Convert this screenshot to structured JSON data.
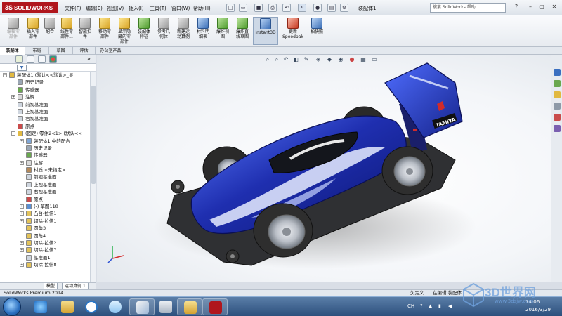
{
  "app": {
    "logo_brand": "SOLIDWORKS",
    "logo_prefix": "3S",
    "doc_title": "装配体1",
    "help_search_placeholder": "搜索 SolidWorks 帮助"
  },
  "menu": [
    "文件(F)",
    "编辑(E)",
    "视图(V)",
    "插入(I)",
    "工具(T)",
    "窗口(W)",
    "帮助(H)"
  ],
  "ribbon": {
    "buttons": [
      {
        "label": "编辑零\n部件",
        "icon": "edit-component-icon",
        "state": "disabled"
      },
      {
        "label": "插入零\n部件",
        "icon": "insert-component-icon",
        "state": "normal"
      },
      {
        "label": "配合",
        "icon": "mate-icon",
        "state": "normal"
      },
      {
        "label": "线性零\n部件...",
        "icon": "linear-pattern-icon",
        "state": "normal"
      },
      {
        "label": "智能扣\n件",
        "icon": "smart-fasteners-icon",
        "state": "normal"
      },
      {
        "label": "移动零\n部件",
        "icon": "move-component-icon",
        "state": "normal"
      },
      {
        "label": "显示隐\n藏的零\n部件",
        "icon": "show-hidden-icon",
        "state": "normal"
      },
      {
        "label": "装配体\n特征",
        "icon": "assembly-features-icon",
        "state": "normal"
      },
      {
        "label": "参考几\n何体",
        "icon": "reference-geometry-icon",
        "state": "normal"
      },
      {
        "label": "新建运\n动算例",
        "icon": "motion-study-icon",
        "state": "normal"
      },
      {
        "label": "材料明\n细表",
        "icon": "bom-icon",
        "state": "normal"
      },
      {
        "label": "爆炸视\n图",
        "icon": "exploded-view-icon",
        "state": "normal"
      },
      {
        "label": "爆炸直\n线草图",
        "icon": "explode-line-sketch-icon",
        "state": "normal"
      },
      {
        "label": "Instant3D",
        "icon": "instant3d-icon",
        "state": "active"
      },
      {
        "label": "更新\nSpeedpak",
        "icon": "speedpak-icon",
        "state": "normal"
      },
      {
        "label": "拍快照",
        "icon": "snapshot-icon",
        "state": "normal"
      }
    ]
  },
  "command_tabs": [
    "装配体",
    "布局",
    "草图",
    "评估",
    "办公室产品"
  ],
  "feature_tree": [
    {
      "label": "装配体1 (默认<<默认>_显",
      "level": 0,
      "expander": "-",
      "icon": "assembly-icon"
    },
    {
      "label": "历史记录",
      "level": 1,
      "expander": "",
      "icon": "history-icon"
    },
    {
      "label": "传感器",
      "level": 1,
      "expander": "",
      "icon": "sensor-icon"
    },
    {
      "label": "注解",
      "level": 1,
      "expander": "+",
      "icon": "annotation-icon"
    },
    {
      "label": "前视基准面",
      "level": 1,
      "expander": "",
      "icon": "plane-icon"
    },
    {
      "label": "上视基准面",
      "level": 1,
      "expander": "",
      "icon": "plane-icon"
    },
    {
      "label": "右视基准面",
      "level": 1,
      "expander": "",
      "icon": "plane-icon"
    },
    {
      "label": "原点",
      "level": 1,
      "expander": "",
      "icon": "origin-icon"
    },
    {
      "label": "(固定) 零件2<1> (默认<<",
      "level": 1,
      "expander": "-",
      "icon": "part-icon"
    },
    {
      "label": "装配体1 中的配合",
      "level": 2,
      "expander": "+",
      "icon": "mate-group-icon"
    },
    {
      "label": "历史记录",
      "level": 2,
      "expander": "",
      "icon": "history-icon"
    },
    {
      "label": "传感器",
      "level": 2,
      "expander": "",
      "icon": "sensor-icon"
    },
    {
      "label": "注解",
      "level": 2,
      "expander": "+",
      "icon": "annotation-icon"
    },
    {
      "label": "材质 <未指定>",
      "level": 2,
      "expander": "",
      "icon": "material-icon"
    },
    {
      "label": "前视基准面",
      "level": 2,
      "expander": "",
      "icon": "plane-icon"
    },
    {
      "label": "上视基准面",
      "level": 2,
      "expander": "",
      "icon": "plane-icon"
    },
    {
      "label": "右视基准面",
      "level": 2,
      "expander": "",
      "icon": "plane-icon"
    },
    {
      "label": "原点",
      "level": 2,
      "expander": "",
      "icon": "origin-icon"
    },
    {
      "label": "(-) 草图118",
      "level": 2,
      "expander": "+",
      "icon": "sketch-icon"
    },
    {
      "label": "凸台-拉伸1",
      "level": 2,
      "expander": "+",
      "icon": "extrude-icon"
    },
    {
      "label": "切除-拉伸1",
      "level": 2,
      "expander": "+",
      "icon": "cut-extrude-icon"
    },
    {
      "label": "圆角3",
      "level": 2,
      "expander": "",
      "icon": "fillet-icon"
    },
    {
      "label": "圆角4",
      "level": 2,
      "expander": "",
      "icon": "fillet-icon"
    },
    {
      "label": "切除-拉伸2",
      "level": 2,
      "expander": "+",
      "icon": "cut-extrude-icon"
    },
    {
      "label": "切除-拉伸7",
      "level": 2,
      "expander": "+",
      "icon": "cut-extrude-icon"
    },
    {
      "label": "基准面1",
      "level": 2,
      "expander": "",
      "icon": "plane-icon"
    },
    {
      "label": "切除-拉伸8",
      "level": 2,
      "expander": "+",
      "icon": "cut-extrude-icon"
    }
  ],
  "model_tabs": [
    "模型",
    "运动算例 1"
  ],
  "status": {
    "left": "SolidWorks Premium 2014",
    "underdefined": "欠定义",
    "editing": "在编辑 装配体"
  },
  "car_decal": "TAMIYA",
  "taskbar": {
    "time": "14:06",
    "date": "2016/3/29"
  },
  "watermark": {
    "text": "3D世界网",
    "url": "www.3dsjw.com"
  },
  "colors": {
    "car_body": "#1f2fb0",
    "car_body_light": "#4a6cff",
    "chassis": "#2b2b2b",
    "tire": "#3a3a3a",
    "rim": "#bfc4cc",
    "brand_red": "#b0161d"
  }
}
